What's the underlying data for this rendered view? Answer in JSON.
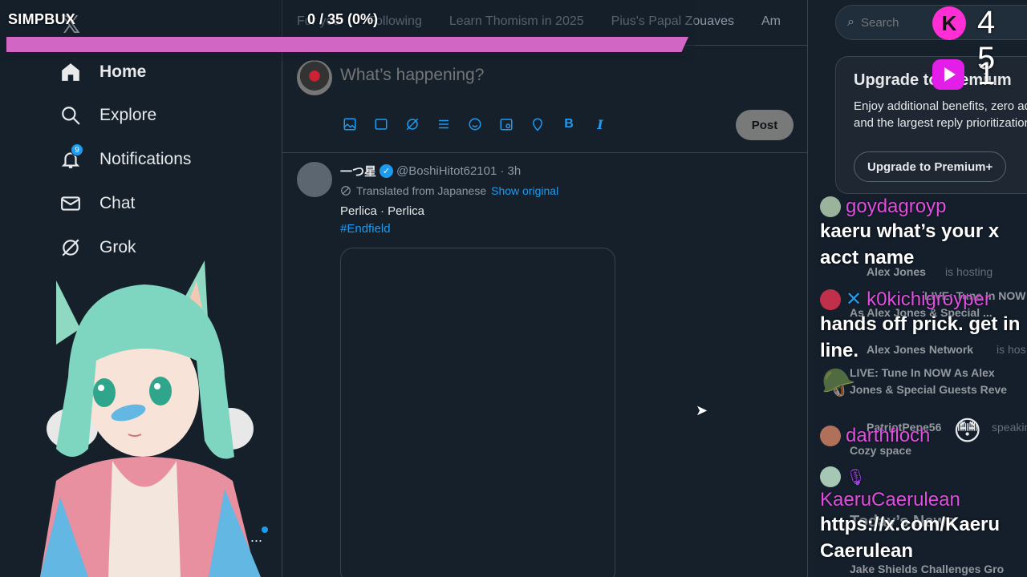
{
  "overlay": {
    "title": "SIMPBUX",
    "count": "0 / 35 (0%)",
    "progress": 0,
    "kick_count": "4 5",
    "kick_logo_letter": "K",
    "play_count": "1"
  },
  "nav": {
    "items": [
      {
        "label": "Home",
        "icon": "home-icon"
      },
      {
        "label": "Explore",
        "icon": "search-icon"
      },
      {
        "label": "Notifications",
        "icon": "bell-icon",
        "badge": "9"
      },
      {
        "label": "Chat",
        "icon": "mail-icon"
      },
      {
        "label": "Grok",
        "icon": "grok-icon"
      }
    ],
    "more": "..."
  },
  "main": {
    "tabs": [
      "For you",
      "Following",
      "Learn Thomism in 2025",
      "Pius's Papal Zouaves",
      "Am"
    ],
    "composer_placeholder": "What’s happening?",
    "post_button": "Post",
    "tweet": {
      "name": "一つ星",
      "handle": "@BoshiHitot62101",
      "time": "· 3h",
      "translated": "Translated from Japanese",
      "show_original": "Show original",
      "text": "Perlica · Perlica",
      "hashtag": "#Endfield"
    }
  },
  "right": {
    "search_placeholder": "Search",
    "premium": {
      "title": "Upgrade to Premium",
      "desc": "Enjoy additional benefits, zero ads and the largest reply prioritization.",
      "button": "Upgrade to Premium+"
    },
    "background_lines": [
      {
        "text": "Alex Jones",
        "suffix": "is hosting"
      },
      {
        "text": "LIVE: Tune In NOW"
      },
      {
        "text": "As Alex Jones & Special ..."
      },
      {
        "text": "Alex Jones Network",
        "suffix": "is hos"
      },
      {
        "text": "LIVE: Tune In NOW As Alex"
      },
      {
        "text": "Jones & Special Guests Reve"
      },
      {
        "text": "PatriotPepe56",
        "suffix": "speaking"
      },
      {
        "text": "Cozy space"
      },
      {
        "text": "Today’s News"
      },
      {
        "text": "Jake Shields Challenges Gro"
      }
    ]
  },
  "chat": [
    {
      "user": "goydagroyp",
      "text": "kaeru what’s your x acct name"
    },
    {
      "user": "k0kichigroyper",
      "text": "hands off prick. get in line."
    },
    {
      "user": "darthfloch",
      "text": ""
    },
    {
      "user": "KaeruCaerulean",
      "text": "https://x.com/KaeruCaerulean"
    }
  ]
}
